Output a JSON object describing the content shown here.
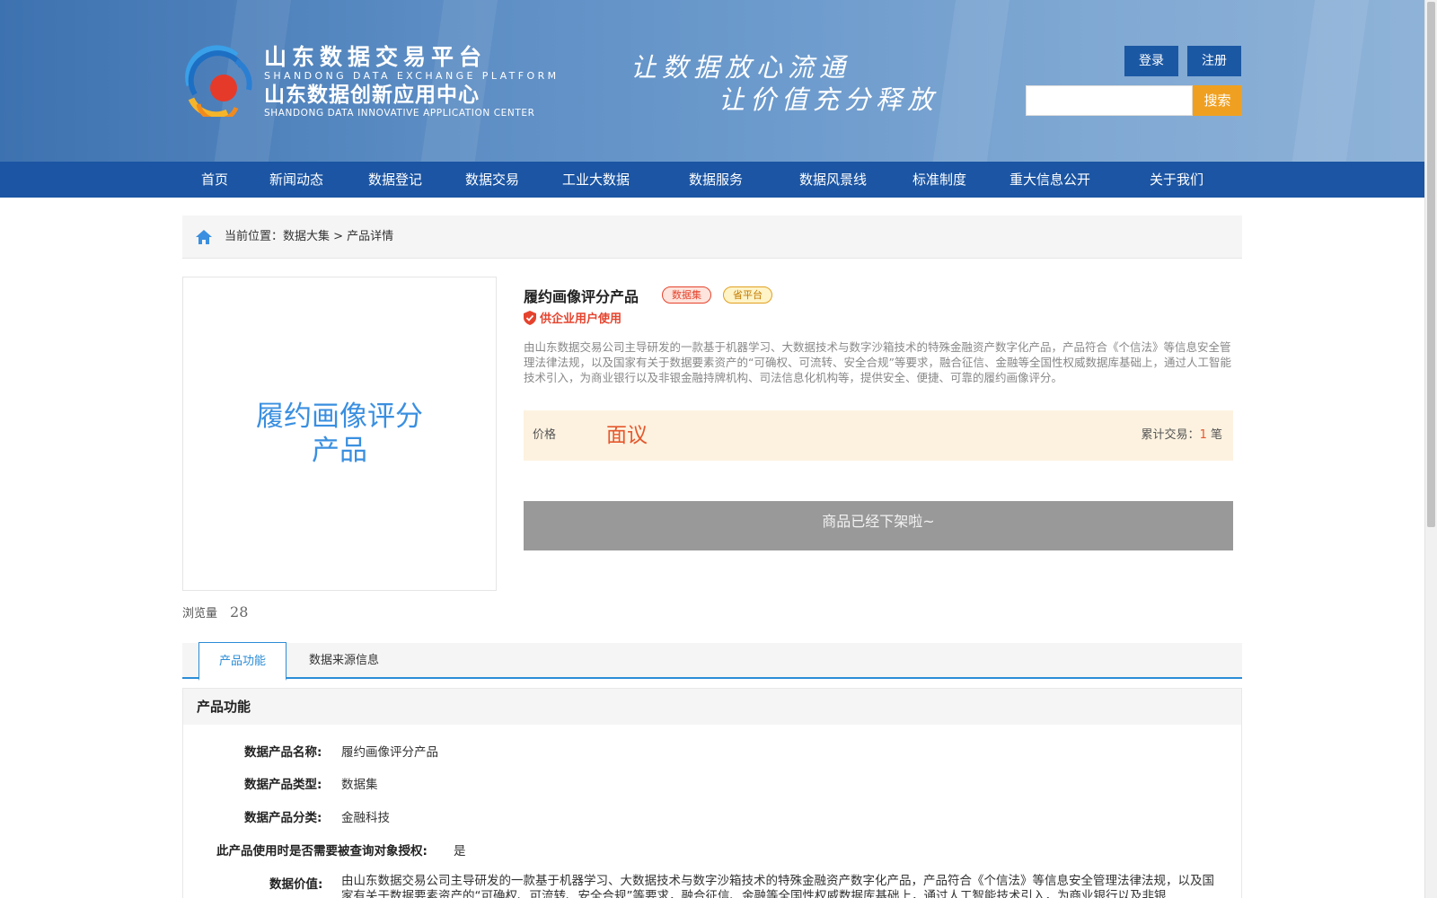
{
  "header": {
    "logo_cn_1": "山东数据交易平台",
    "logo_en_1": "SHANDONG DATA EXCHANGE PLATFORM",
    "logo_cn_2": "山东数据创新应用中心",
    "logo_en_2": "SHANDONG DATA INNOVATIVE APPLICATION CENTER",
    "slogan_1": "让数据放心流通",
    "slogan_2": "让价值充分释放",
    "login_label": "登录",
    "register_label": "注册",
    "search_placeholder": "",
    "search_label": "搜索"
  },
  "nav": {
    "items": [
      "首页",
      "新闻动态",
      "数据登记",
      "数据交易",
      "工业大数据",
      "数据服务",
      "数据风景线",
      "标准制度",
      "重大信息公开",
      "关于我们"
    ]
  },
  "breadcrumb": {
    "text": "当前位置：数据大集 > 产品详情"
  },
  "product": {
    "image_text": "履约画像评分产品",
    "title": "履约画像评分产品",
    "tag_1": "数据集",
    "tag_2": "省平台",
    "enterprise_note": "供企业用户使用",
    "description": "由山东数据交易公司主导研发的一款基于机器学习、大数据技术与数字沙箱技术的特殊金融资产数字化产品，产品符合《个信法》等信息安全管理法律法规，以及国家有关于数据要素资产的“可确权、可流转、安全合规”等要求，融合征信、金融等全国性权威数据库基础上，通过人工智能技术引入，为商业银行以及非银金融持牌机构、司法信息化机构等，提供安全、便捷、可靠的履约画像评分。",
    "price_label": "价格",
    "price_value": "面议",
    "tx_label": "累计交易：",
    "tx_count": "1",
    "tx_unit": "笔",
    "offline_label": "商品已经下架啦~",
    "views_label": "浏览量",
    "views_value": "28"
  },
  "tabs": {
    "items": [
      "产品功能",
      "数据来源信息"
    ],
    "active": 0
  },
  "function_section": {
    "heading": "产品功能",
    "name_key": "数据产品名称:",
    "name_val": "履约画像评分产品",
    "type_key": "数据产品类型:",
    "type_val": "数据集",
    "category_key": "数据产品分类:",
    "category_val": "金融科技",
    "auth_key": "此产品使用时是否需要被查询对象授权:",
    "auth_val": "是",
    "value_key": "数据价值:",
    "value_val": "由山东数据交易公司主导研发的一款基于机器学习、大数据技术与数字沙箱技术的特殊金融资产数字化产品，产品符合《个信法》等信息安全管理法律法规，以及国家有关于数据要素资产的“可确权、可流转、安全合规”等要求，融合征信、金融等全国性权威数据库基础上，通过人工智能技术引入，为商业银行以及非银"
  },
  "colors": {
    "nav_bg": "#1b55a3",
    "accent": "#2b8dd6",
    "search_btn": "#f0a020",
    "price": "#e5582d"
  }
}
